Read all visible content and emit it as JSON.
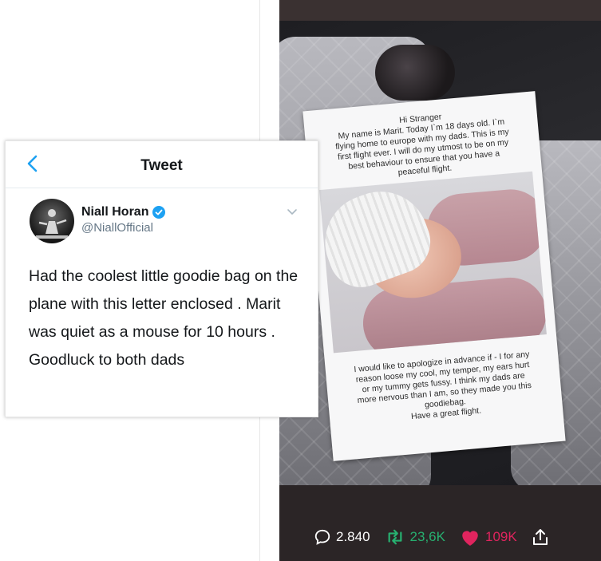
{
  "tweet": {
    "header_title": "Tweet",
    "author_name": "Niall Horan",
    "author_handle": "@NiallOfficial",
    "text": "Had the coolest little goodie bag on the plane with this letter enclosed . Marit was quiet as a mouse for 10 hours . Goodluck to both dads",
    "icons": {
      "back": "chevron-left-icon",
      "verified": "verified-badge-icon",
      "menu": "chevron-down-icon"
    },
    "colors": {
      "accent": "#1da1f2",
      "text": "#14171a",
      "secondary": "#657786"
    }
  },
  "letter": {
    "top_lines": [
      "Hi Stranger",
      "My name is Marit. Today I`m 18 days old. I`m",
      "flying home to europe with my dads. This is my",
      "first flight ever. I will do my utmost to be on my",
      "best behaviour to ensure that you have a",
      "peaceful flight."
    ],
    "bottom_lines": [
      "I would like to apologize in advance if - I for any",
      "reason loose my cool, my temper, my ears hurt",
      "or my tummy gets fussy. I think my dads are",
      "more nervous than I am, so they made you this",
      "goodiebag.",
      "Have a great flight."
    ]
  },
  "media_stats": {
    "comments": "2.840",
    "retweets": "23,6K",
    "likes": "109K",
    "icons": {
      "comments": "comment-bubble-icon",
      "retweets": "retweet-icon",
      "likes": "heart-icon",
      "share": "share-icon"
    },
    "colors": {
      "retweet": "#27b070",
      "like": "#e0245e"
    }
  }
}
